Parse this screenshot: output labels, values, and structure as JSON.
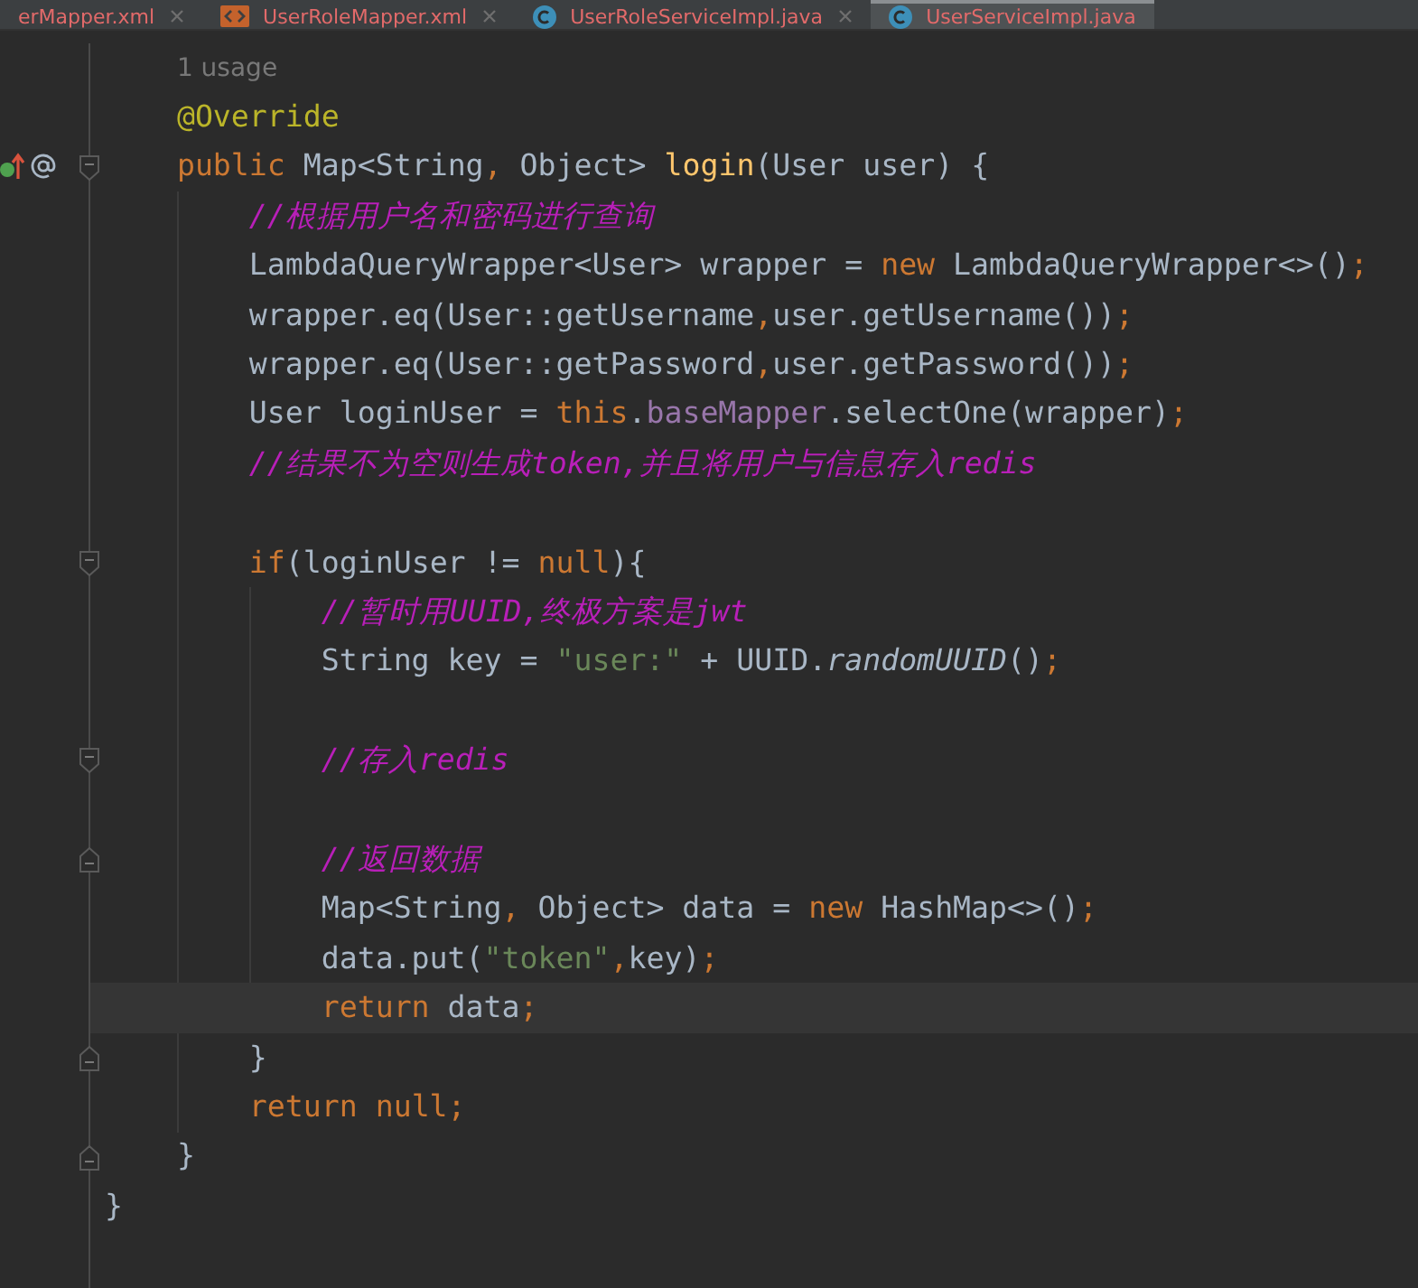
{
  "tabs": [
    {
      "label": "erMapper.xml",
      "selected": false,
      "closable": true
    },
    {
      "label": "UserRoleMapper.xml",
      "kind": "xml",
      "selected": false,
      "closable": true
    },
    {
      "label": "UserRoleServiceImpl.java",
      "kind": "java",
      "selected": false,
      "closable": true
    },
    {
      "label": "UserServiceImpl.java",
      "kind": "java",
      "selected": true,
      "closable": false
    }
  ],
  "code": [
    {
      "kind": "scope",
      "children": [
        {
          "kind": "hint",
          "tokens": [
            {
              "kind": "hint",
              "text": "1 usage"
            }
          ]
        },
        {
          "kind": "line",
          "tokens": [
            {
              "kind": "annotation",
              "text": "@Override"
            }
          ]
        },
        {
          "kind": "line",
          "gutter_icons": true,
          "fold_start": true,
          "tokens": [
            {
              "kind": "keyword",
              "text": "public"
            },
            {
              "kind": "plain",
              "text": " Map<String"
            },
            {
              "kind": "keyword",
              "text": ","
            },
            {
              "kind": "plain",
              "text": " Object> "
            },
            {
              "kind": "function",
              "text": "login"
            },
            {
              "kind": "plain",
              "text": "(User user) {"
            }
          ],
          "children": [
            {
              "kind": "comment",
              "tokens": [
                {
                  "kind": "comment",
                  "text": "//根据用户名和密码进行查询"
                }
              ]
            },
            {
              "kind": "line",
              "tokens": [
                {
                  "kind": "plain",
                  "text": "LambdaQueryWrapper<User> wrapper = "
                },
                {
                  "kind": "keyword",
                  "text": "new"
                },
                {
                  "kind": "plain",
                  "text": " LambdaQueryWrapper<>()"
                },
                {
                  "kind": "keyword",
                  "text": ";"
                }
              ]
            },
            {
              "kind": "line",
              "tokens": [
                {
                  "kind": "plain",
                  "text": "wrapper.eq(User::getUsername"
                },
                {
                  "kind": "keyword",
                  "text": ","
                },
                {
                  "kind": "plain",
                  "text": "user.getUsername())"
                },
                {
                  "kind": "keyword",
                  "text": ";"
                }
              ]
            },
            {
              "kind": "line",
              "tokens": [
                {
                  "kind": "plain",
                  "text": "wrapper.eq(User::getPassword"
                },
                {
                  "kind": "keyword",
                  "text": ","
                },
                {
                  "kind": "plain",
                  "text": "user.getPassword())"
                },
                {
                  "kind": "keyword",
                  "text": ";"
                }
              ]
            },
            {
              "kind": "line",
              "tokens": [
                {
                  "kind": "plain",
                  "text": "User loginUser = "
                },
                {
                  "kind": "keyword",
                  "text": "this"
                },
                {
                  "kind": "plain",
                  "text": "."
                },
                {
                  "kind": "field",
                  "text": "baseMapper"
                },
                {
                  "kind": "plain",
                  "text": ".selectOne(wrapper)"
                },
                {
                  "kind": "keyword",
                  "text": ";"
                }
              ]
            },
            {
              "kind": "comment",
              "tokens": [
                {
                  "kind": "comment",
                  "text": "//结果不为空则生成token,并且将用户与信息存入redis"
                }
              ]
            },
            {
              "kind": "blank"
            },
            {
              "kind": "line",
              "fold_start": true,
              "tokens": [
                {
                  "kind": "keyword",
                  "text": "if"
                },
                {
                  "kind": "plain",
                  "text": "(loginUser != "
                },
                {
                  "kind": "keyword",
                  "text": "null"
                },
                {
                  "kind": "plain",
                  "text": "){"
                }
              ],
              "children": [
                {
                  "kind": "comment",
                  "tokens": [
                    {
                      "kind": "comment",
                      "text": "//暂时用UUID,终极方案是jwt"
                    }
                  ]
                },
                {
                  "kind": "line",
                  "tokens": [
                    {
                      "kind": "plain",
                      "text": "String key = "
                    },
                    {
                      "kind": "string",
                      "text": "\"user:\""
                    },
                    {
                      "kind": "plain",
                      "text": " + UUID."
                    },
                    {
                      "kind": "static",
                      "text": "randomUUID"
                    },
                    {
                      "kind": "plain",
                      "text": "()"
                    },
                    {
                      "kind": "keyword",
                      "text": ";"
                    }
                  ]
                },
                {
                  "kind": "blank"
                },
                {
                  "kind": "comment",
                  "fold_start": true,
                  "tokens": [
                    {
                      "kind": "comment",
                      "text": "//存入redis"
                    }
                  ]
                },
                {
                  "kind": "blank"
                },
                {
                  "kind": "comment",
                  "fold_end": true,
                  "tokens": [
                    {
                      "kind": "comment",
                      "text": "//返回数据"
                    }
                  ]
                },
                {
                  "kind": "line",
                  "tokens": [
                    {
                      "kind": "plain",
                      "text": "Map<String"
                    },
                    {
                      "kind": "keyword",
                      "text": ","
                    },
                    {
                      "kind": "plain",
                      "text": " Object> data = "
                    },
                    {
                      "kind": "keyword",
                      "text": "new"
                    },
                    {
                      "kind": "plain",
                      "text": " HashMap<>()"
                    },
                    {
                      "kind": "keyword",
                      "text": ";"
                    }
                  ]
                },
                {
                  "kind": "line",
                  "tokens": [
                    {
                      "kind": "plain",
                      "text": "data.put("
                    },
                    {
                      "kind": "string",
                      "text": "\"token\""
                    },
                    {
                      "kind": "keyword",
                      "text": ","
                    },
                    {
                      "kind": "plain",
                      "text": "key)"
                    },
                    {
                      "kind": "keyword",
                      "text": ";"
                    }
                  ]
                },
                {
                  "kind": "line",
                  "current": true,
                  "tokens": [
                    {
                      "kind": "keyword",
                      "text": "return"
                    },
                    {
                      "kind": "plain",
                      "text": " data"
                    },
                    {
                      "kind": "keyword",
                      "text": ";"
                    }
                  ]
                }
              ]
            },
            {
              "kind": "line",
              "fold_end": true,
              "tokens": [
                {
                  "kind": "plain",
                  "text": "}"
                }
              ]
            },
            {
              "kind": "line",
              "tokens": [
                {
                  "kind": "keyword",
                  "text": "return null;"
                }
              ]
            }
          ]
        },
        {
          "kind": "line",
          "fold_end": true,
          "tokens": [
            {
              "kind": "plain",
              "text": "}"
            }
          ]
        }
      ]
    },
    {
      "kind": "line",
      "tokens": [
        {
          "kind": "plain",
          "text": "}"
        }
      ]
    }
  ]
}
